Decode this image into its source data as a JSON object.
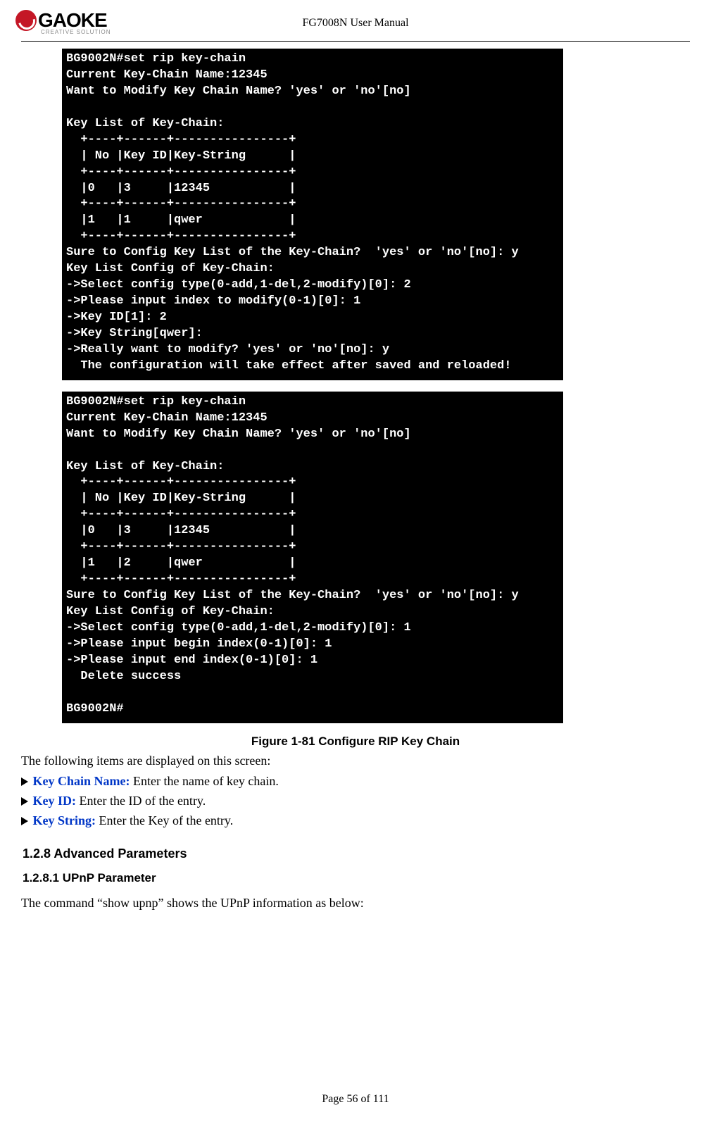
{
  "header": {
    "logo_text": "GAOKE",
    "logo_tagline": "CREATIVE SOLUTION",
    "doc_title": "FG7008N User Manual"
  },
  "terminal1": {
    "lines": [
      "BG9002N#set rip key-chain",
      "Current Key-Chain Name:12345",
      "Want to Modify Key Chain Name? 'yes' or 'no'[no]",
      "",
      "Key List of Key-Chain:",
      "  +----+------+----------------+",
      "  | No |Key ID|Key-String      |",
      "  +----+------+----------------+",
      "  |0   |3     |12345           |",
      "  +----+------+----------------+",
      "  |1   |1     |qwer            |",
      "  +----+------+----------------+",
      "Sure to Config Key List of the Key-Chain?  'yes' or 'no'[no]: y",
      "Key List Config of Key-Chain:",
      "->Select config type(0-add,1-del,2-modify)[0]: 2",
      "->Please input index to modify(0-1)[0]: 1",
      "->Key ID[1]: 2",
      "->Key String[qwer]:",
      "->Really want to modify? 'yes' or 'no'[no]: y",
      "  The configuration will take effect after saved and reloaded!"
    ]
  },
  "terminal2": {
    "lines": [
      "BG9002N#set rip key-chain",
      "Current Key-Chain Name:12345",
      "Want to Modify Key Chain Name? 'yes' or 'no'[no]",
      "",
      "Key List of Key-Chain:",
      "  +----+------+----------------+",
      "  | No |Key ID|Key-String      |",
      "  +----+------+----------------+",
      "  |0   |3     |12345           |",
      "  +----+------+----------------+",
      "  |1   |2     |qwer            |",
      "  +----+------+----------------+",
      "Sure to Config Key List of the Key-Chain?  'yes' or 'no'[no]: y",
      "Key List Config of Key-Chain:",
      "->Select config type(0-add,1-del,2-modify)[0]: 1",
      "->Please input begin index(0-1)[0]: 1",
      "->Please input end index(0-1)[0]: 1",
      "  Delete success",
      "",
      "BG9002N#"
    ]
  },
  "figure_caption": "Figure 1-81    Configure RIP Key Chain",
  "intro_text": "The following items are displayed on this screen:",
  "fields": [
    {
      "label": "Key Chain Name:",
      "desc": " Enter the name of key chain."
    },
    {
      "label": "Key ID:",
      "desc": "           Enter the ID of the entry."
    },
    {
      "label": "Key String:",
      "desc": "    Enter the Key of the entry."
    }
  ],
  "section_h3": "1.2.8    Advanced Parameters",
  "section_h4": "1.2.8.1    UPnP Parameter",
  "upnp_text": "The command “show upnp” shows the UPnP information as below:",
  "footer": "Page 56 of 111"
}
